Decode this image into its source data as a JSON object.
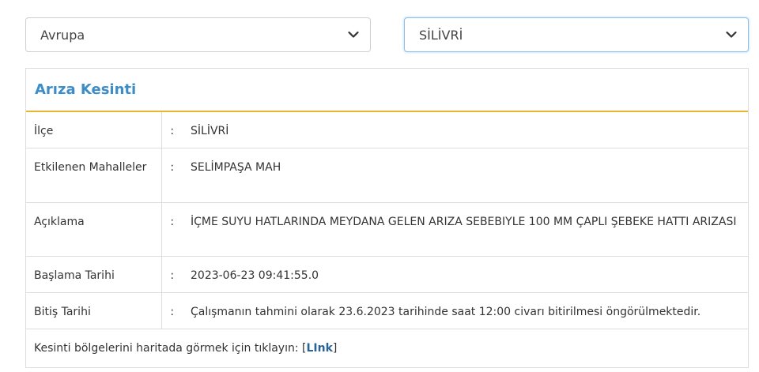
{
  "region_select": {
    "value": "Avrupa",
    "icon": "chevron-down-icon"
  },
  "district_select": {
    "value": "SİLİVRİ",
    "icon": "chevron-down-icon"
  },
  "panel": {
    "title": "Arıza Kesinti",
    "rows": [
      {
        "label": "İlçe",
        "sep": ":",
        "value": "SİLİVRİ"
      },
      {
        "label": "Etkilenen Mahalleler",
        "sep": ":",
        "value": "SELİMPAŞA MAH"
      },
      {
        "label": "Açıklama",
        "sep": ":",
        "value": "İÇME SUYU HATLARINDA MEYDANA GELEN ARIZA SEBEBIYLE 100 MM ÇAPLI ŞEBEKE HATTI ARIZASI"
      },
      {
        "label": "Başlama Tarihi",
        "sep": ":",
        "value": "2023-06-23 09:41:55.0"
      },
      {
        "label": "Bitiş Tarihi",
        "sep": ":",
        "value": "Çalışmanın tahmini olarak 23.6.2023 tarihinde saat 12:00 civarı bitirilmesi öngörülmektedir."
      }
    ],
    "footer": {
      "text": "Kesinti bölgelerini haritada görmek için tıklayın:",
      "bracket_open": "[",
      "link_label": "LInk",
      "bracket_close": "]"
    }
  },
  "colors": {
    "title": "#3c8dc8",
    "header_underline": "#e8b62a",
    "link": "#2a6496",
    "focus_border": "#8cbfe3"
  }
}
